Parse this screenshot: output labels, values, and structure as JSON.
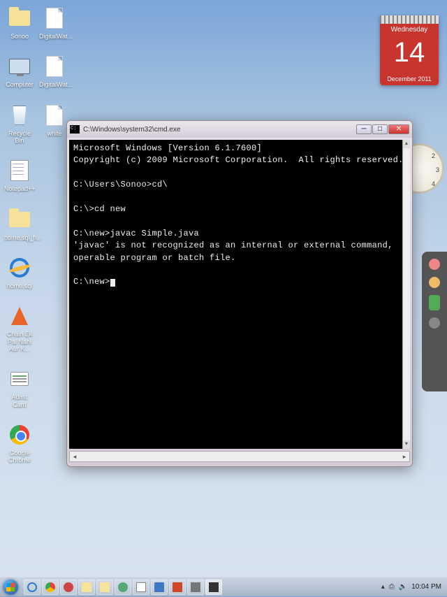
{
  "calendar": {
    "dayName": "Wednesday",
    "dayNum": "14",
    "monthYear": "December 2011"
  },
  "clock": {
    "n2": "2",
    "n3": "3",
    "n4": "4"
  },
  "desktop": {
    "col1": [
      {
        "name": "Sonoo",
        "icon": "folder"
      },
      {
        "name": "Computer",
        "icon": "computer"
      },
      {
        "name": "Recycle Bin",
        "icon": "recycle"
      },
      {
        "name": "Notepad++",
        "icon": "notepad"
      },
      {
        "name": "home.sql_fi...",
        "icon": "folder"
      },
      {
        "name": "home.sql",
        "icon": "ie"
      },
      {
        "name": "Chain Ek Pal Nahi Aur K...",
        "icon": "vlc"
      },
      {
        "name": "Admit Card",
        "icon": "card"
      },
      {
        "name": "Google Chrome",
        "icon": "chrome"
      }
    ],
    "col2": [
      {
        "name": "DigitalWat...",
        "icon": "file"
      },
      {
        "name": "DigitalWat...",
        "icon": "file"
      },
      {
        "name": "white",
        "icon": "file"
      }
    ]
  },
  "cmd": {
    "title": "C:\\Windows\\system32\\cmd.exe",
    "lines": {
      "l1": "Microsoft Windows [Version 6.1.7600]",
      "l2": "Copyright (c) 2009 Microsoft Corporation.  All rights reserved.",
      "l3": "C:\\Users\\Sonoo>cd\\",
      "l4": "C:\\>cd new",
      "l5": "C:\\new>javac Simple.java",
      "l6": "'javac' is not recognized as an internal or external command,",
      "l7": "operable program or batch file.",
      "l8": "C:\\new>"
    }
  },
  "taskbar": {
    "items": [
      {
        "name": "ie",
        "cls": "ti-ie"
      },
      {
        "name": "chrome",
        "cls": "ti-chrome"
      },
      {
        "name": "red",
        "cls": "ti-red"
      },
      {
        "name": "folder",
        "cls": "ti-folder"
      },
      {
        "name": "folder2",
        "cls": "ti-folder"
      },
      {
        "name": "green",
        "cls": "ti-green"
      },
      {
        "name": "notepad",
        "cls": "ti-np"
      },
      {
        "name": "word",
        "cls": "ti-doc"
      },
      {
        "name": "ppt",
        "cls": "ti-ppt"
      },
      {
        "name": "grey",
        "cls": "ti-gr"
      },
      {
        "name": "cmd",
        "cls": "ti-trm",
        "active": true
      }
    ],
    "tray": {
      "expand": "▴",
      "net": "⎙",
      "vol": "🔈",
      "time": "10:04 PM"
    }
  }
}
